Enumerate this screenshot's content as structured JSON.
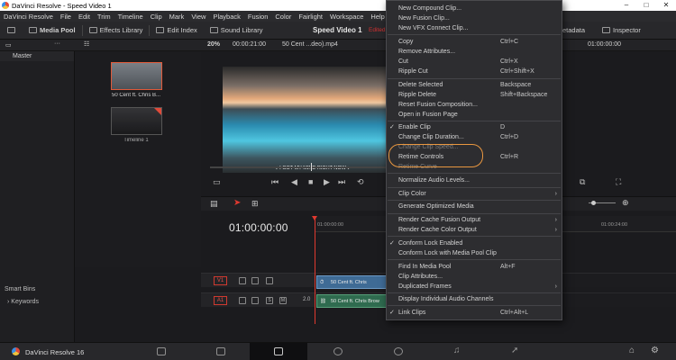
{
  "window": {
    "title": "DaVinci Resolve - Speed Video 1",
    "controls": [
      "–",
      "□",
      "✕"
    ]
  },
  "menubar": [
    "DaVinci Resolve",
    "File",
    "Edit",
    "Trim",
    "Timeline",
    "Clip",
    "Mark",
    "View",
    "Playback",
    "Fusion",
    "Color",
    "Fairlight",
    "Workspace",
    "Help"
  ],
  "toolbar": {
    "media_pool": "Media Pool",
    "effects_library": "Effects Library",
    "edit_index": "Edit Index",
    "sound_library": "Sound Library",
    "project_title": "Speed Video 1",
    "edited": "Edited",
    "metadata": "etadata",
    "inspector": "Inspector"
  },
  "subbar": {
    "zoom": "20%",
    "timecode": "00:00:21:00",
    "clip_name": "50 Cent ...deo).mp4",
    "right_timecode": "01:00:00:00"
  },
  "left_panel": {
    "master": "Master",
    "smart_bins": "Smart Bins",
    "keywords": "Keywords"
  },
  "media_pool": {
    "items": [
      {
        "label": "50 Cent ft. Chris B..."
      },
      {
        "label": "Timeline 1"
      }
    ]
  },
  "viewer": {
    "subtitle": "♪ I GOT MY MIND RIGHT NOW ♪"
  },
  "timeline": {
    "timecode": "01:00:00:00",
    "ruler": [
      "01:00:00:00",
      "01:00:24:00"
    ],
    "tracks": [
      {
        "label": "V1",
        "clip": "50 Cent ft. Chris"
      },
      {
        "label": "A1",
        "level": "2.0",
        "clip": "50 Cent ft. Chris Brow"
      }
    ]
  },
  "pagebar": {
    "brand": "DaVinci Resolve 16"
  },
  "context_menu": {
    "items": [
      {
        "label": "New Compound Clip...",
        "shortcut": ""
      },
      {
        "label": "New Fusion Clip...",
        "shortcut": ""
      },
      {
        "label": "New VFX Connect Clip...",
        "shortcut": ""
      },
      {
        "label": "Copy",
        "shortcut": "Ctrl+C"
      },
      {
        "label": "Remove Attributes...",
        "shortcut": ""
      },
      {
        "label": "Cut",
        "shortcut": "Ctrl+X"
      },
      {
        "label": "Ripple Cut",
        "shortcut": "Ctrl+Shift+X"
      },
      {
        "label": "Delete Selected",
        "shortcut": "Backspace"
      },
      {
        "label": "Ripple Delete",
        "shortcut": "Shift+Backspace"
      },
      {
        "label": "Reset Fusion Composition...",
        "shortcut": ""
      },
      {
        "label": "Open in Fusion Page",
        "shortcut": ""
      },
      {
        "label": "Enable Clip",
        "shortcut": "D"
      },
      {
        "label": "Change Clip Duration...",
        "shortcut": "Ctrl+D"
      },
      {
        "label": "Change Clip Speed...",
        "shortcut": ""
      },
      {
        "label": "Retime Controls",
        "shortcut": "Ctrl+R"
      },
      {
        "label": "Retime Curve",
        "shortcut": ""
      },
      {
        "label": "Normalize Audio Levels...",
        "shortcut": ""
      },
      {
        "label": "Clip Color",
        "shortcut": ""
      },
      {
        "label": "Generate Optimized Media",
        "shortcut": ""
      },
      {
        "label": "Render Cache Fusion Output",
        "shortcut": ""
      },
      {
        "label": "Render Cache Color Output",
        "shortcut": ""
      },
      {
        "label": "Conform Lock Enabled",
        "shortcut": ""
      },
      {
        "label": "Conform Lock with Media Pool Clip",
        "shortcut": ""
      },
      {
        "label": "Find In Media Pool",
        "shortcut": "Alt+F"
      },
      {
        "label": "Clip Attributes...",
        "shortcut": ""
      },
      {
        "label": "Duplicated Frames",
        "shortcut": ""
      },
      {
        "label": "Display Individual Audio Channels",
        "shortcut": ""
      },
      {
        "label": "Link Clips",
        "shortcut": "Ctrl+Alt+L"
      }
    ]
  },
  "colors": {
    "accent_red": "#e0392f",
    "highlight_orange": "#e99740",
    "video_clip": "#3f6b95",
    "audio_clip": "#2f6b4f"
  }
}
